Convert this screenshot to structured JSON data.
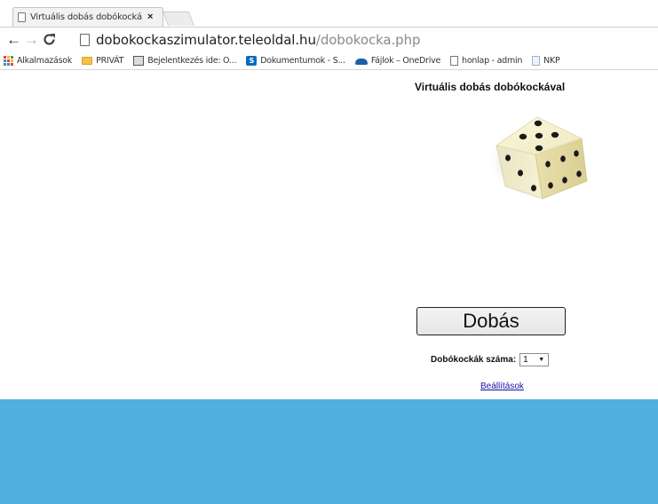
{
  "browser": {
    "tab_title": "Virtuális dobás dobókocká",
    "tab_close": "×",
    "url_host": "dobokockaszimulator.teleoldal.hu",
    "url_path": "/dobokocka.php",
    "nav": {
      "back": "←",
      "forward": "→",
      "reload": "C"
    }
  },
  "bookmarks": [
    {
      "label": "Alkalmazások",
      "icon": "apps-icon"
    },
    {
      "label": "PRIVÁT",
      "icon": "folder-icon"
    },
    {
      "label": "Bejelentkezés ide: O...",
      "icon": "photo-icon"
    },
    {
      "label": "Dokumentumok - S...",
      "icon": "sharepoint-icon"
    },
    {
      "label": "Fájlok – OneDrive",
      "icon": "onedrive-icon"
    },
    {
      "label": "honlap - admin",
      "icon": "page-icon"
    },
    {
      "label": "NKP",
      "icon": "page-icon"
    }
  ],
  "page": {
    "title": "Virtuális dobás dobókockával",
    "dice_face_up": 5,
    "roll_button": "Dobás",
    "count_label": "Dobókockák száma:",
    "count_value": "1",
    "count_arrow": "▼",
    "settings_link": "Beállítások"
  },
  "colors": {
    "footer_band": "#52afe1",
    "die_face": "#f3efc8",
    "link": "#1a0dab"
  }
}
